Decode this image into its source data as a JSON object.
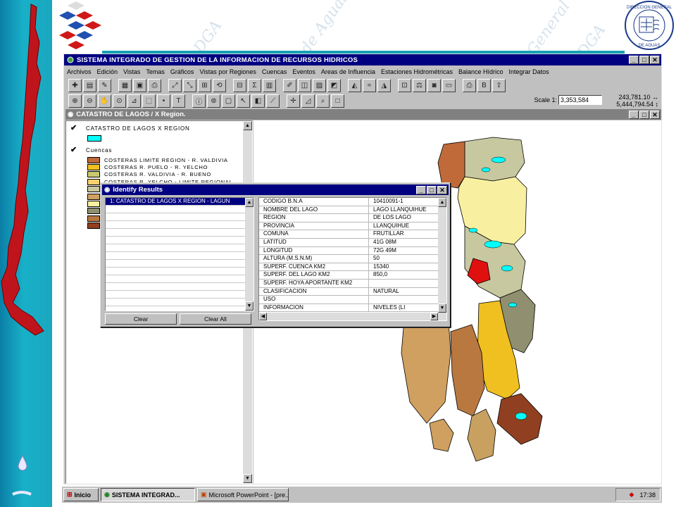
{
  "app": {
    "title": "SISTEMA INTEGRADO DE GESTION DE LA INFORMACION DE RECURSOS HIDRICOS",
    "window_controls": [
      "_",
      "□",
      "✕"
    ]
  },
  "menu": [
    "Archivos",
    "Edición",
    "Vistas",
    "Temas",
    "Gráficos",
    "Vistas por Regiones",
    "Cuencas",
    "Eventos",
    "Areas de Influencia",
    "Estaciones Hidrométricas",
    "Balance Hídrico",
    "Integrar Datos"
  ],
  "toolbar": {
    "scale_label": "Scale 1:",
    "scale_value": "3,353,584",
    "coord_x": "243,781.10",
    "coord_y": "5,444,794.54"
  },
  "view": {
    "title": "CATASTRO DE LAGOS / X Region.",
    "themes": {
      "lakes_title": "CATASTRO DE LAGOS X REGION",
      "lakes_color": "#00ffff",
      "basins_title": "Cuencas",
      "basins": [
        {
          "label": "COSTERAS LIMITE REGION - R. VALDIVIA",
          "color": "#c06a3a"
        },
        {
          "label": "COSTERAS R. PUELO - R. YELCHO",
          "color": "#f0c020"
        },
        {
          "label": "COSTERAS R. VALDIVIA - R. BUENO",
          "color": "#c8c870"
        },
        {
          "label": "COSTERAS R. YELCHO - LIMITE REGIONAL",
          "color": "#f8d070"
        },
        {
          "label": "",
          "color": "#c8c8a0"
        },
        {
          "label": "",
          "color": "#d0a060"
        },
        {
          "label": "",
          "color": "#f8f0a0"
        },
        {
          "label": "",
          "color": "#909070"
        },
        {
          "label": "",
          "color": "#b87840"
        },
        {
          "label": "",
          "color": "#904020"
        }
      ]
    }
  },
  "identify": {
    "title": "Identify Results",
    "features": [
      "1:  CATASTRO DE LAGOS X REGION - LAGUN"
    ],
    "attributes": [
      {
        "key": "CODIGO B.N.A",
        "value": "10410091-1"
      },
      {
        "key": "NOMBRE DEL LAGO",
        "value": "LAGO LLANQUIHUE"
      },
      {
        "key": "REGION",
        "value": "DE LOS LAGO"
      },
      {
        "key": "PROVINCIA",
        "value": "LLANQUIHUE"
      },
      {
        "key": "COMUNA",
        "value": "FRUTILLAR"
      },
      {
        "key": "LATITUD",
        "value": "41G 08M"
      },
      {
        "key": "LONGITUD",
        "value": "72G 49M"
      },
      {
        "key": "ALTURA (M.S.N.M)",
        "value": "50"
      },
      {
        "key": "SUPERF. CUENCA KM2",
        "value": "15340"
      },
      {
        "key": "SUPERF. DEL LAGO KM2",
        "value": "850,0"
      },
      {
        "key": "SUPERF. HOYA APORTANTE KM2",
        "value": ""
      },
      {
        "key": "CLASIFICACION",
        "value": "NATURAL"
      },
      {
        "key": "USO",
        "value": ""
      },
      {
        "key": "INFORMACION",
        "value": "NIVELES (LI"
      }
    ],
    "clear_label": "Clear",
    "clear_all_label": "Clear All"
  },
  "taskbar": {
    "start_label": "Inicio",
    "tasks": [
      "SISTEMA INTEGRAD...",
      "Microsoft PowerPoint - [pre..."
    ],
    "clock": "17:38"
  },
  "watermarks": [
    "DGA",
    "de Aguas",
    "General",
    "DGA",
    "General",
    "del"
  ],
  "seal_text": [
    "DIRECCION GENERAL",
    "DE AGUAS"
  ]
}
